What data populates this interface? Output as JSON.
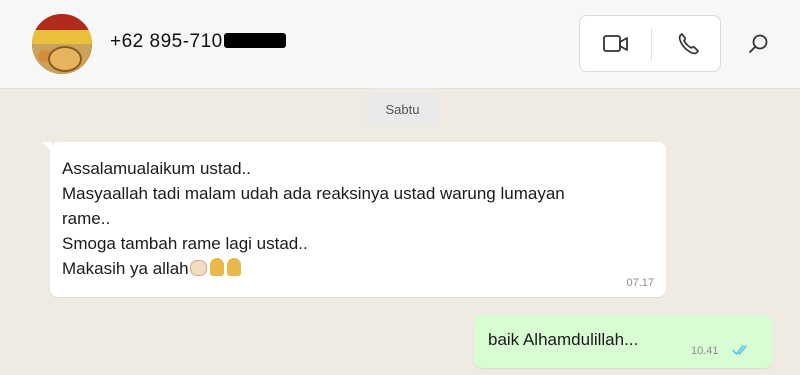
{
  "header": {
    "contact_name": "+62 895-710",
    "avatar_icon": "restaurant-logo",
    "video_call_icon": "video-camera-icon",
    "voice_call_icon": "phone-icon",
    "search_icon": "search-icon"
  },
  "date_divider": "Sabtu",
  "messages": [
    {
      "direction": "incoming",
      "lines": [
        "Assalamualaikum ustad..",
        "Masyaallah tadi malam udah ada reaksinya ustad warung lumayan",
        "rame..",
        "Smoga tambah rame lagi ustad..",
        "Makasih ya allah"
      ],
      "time": "07.17"
    },
    {
      "direction": "outgoing",
      "text": "baik Alhamdulillah...",
      "time": "10.41",
      "status": "read"
    }
  ],
  "colors": {
    "chat_bg": "#efeae2",
    "incoming_bubble": "#ffffff",
    "outgoing_bubble": "#d9fdd3",
    "read_ticks": "#53bdeb"
  }
}
